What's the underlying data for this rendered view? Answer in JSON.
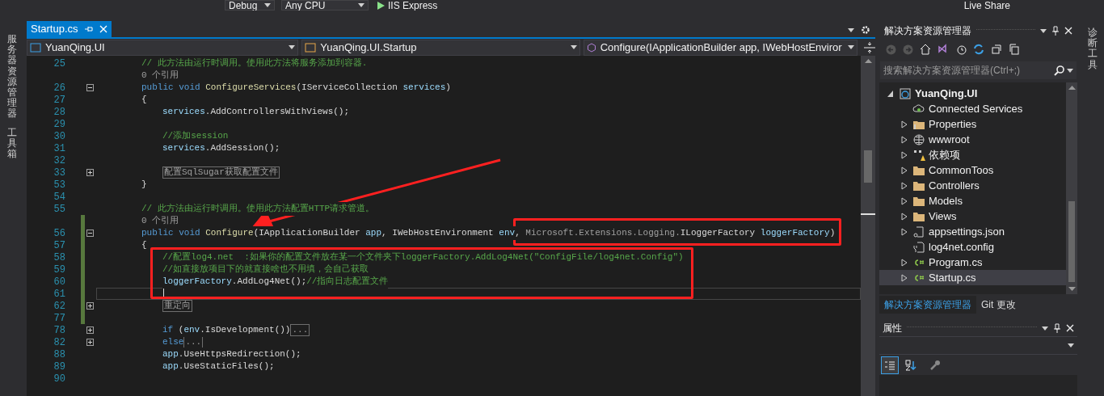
{
  "toolbar": {
    "items": [
      {
        "kind": "dropdown",
        "label": "Debug"
      },
      {
        "kind": "dropdown",
        "label": "Any CPU"
      },
      {
        "kind": "run",
        "label": "IIS Express"
      }
    ],
    "live_share": "Live Share"
  },
  "left_strip": [
    "服务器资源管理器",
    "工具箱"
  ],
  "right_strip": [
    "诊断工具"
  ],
  "editor": {
    "tabs": [
      {
        "label": "Startup.cs",
        "selected": true
      }
    ],
    "nav": [
      "YuanQing.UI",
      "YuanQing.UI.Startup",
      "Configure(IApplicationBuilder app, IWebHostEnviror"
    ],
    "lines": [
      {
        "number": "25",
        "segments": [
          {
            "text": "// 此方法由运行时调用。使用此方法将服务添加到容器.",
            "kind": "comment"
          }
        ]
      },
      {
        "segments": [
          {
            "text": "0 个引用",
            "kind": "lens"
          }
        ]
      },
      {
        "number": "26",
        "folded": false,
        "segments": [
          {
            "text": "public void ",
            "kind": "kw"
          },
          {
            "text": "ConfigureServices",
            "kind": "method"
          },
          {
            "text": "(IServiceCollection ",
            "kind": "plain"
          },
          {
            "text": "services",
            "kind": "ident"
          },
          {
            "text": ")",
            "kind": "plain"
          }
        ]
      },
      {
        "number": "27",
        "segments": [
          {
            "text": "{",
            "kind": "plain"
          }
        ],
        "children": [
          {
            "number": "28",
            "segments": [
              {
                "text": "services",
                "kind": "ident"
              },
              {
                "text": ".AddControllersWithViews();",
                "kind": "plain"
              }
            ]
          },
          {
            "number": "29"
          },
          {
            "number": "30",
            "segments": [
              {
                "text": "//添加session",
                "kind": "comment"
              }
            ]
          },
          {
            "number": "31",
            "segments": [
              {
                "text": "services",
                "kind": "ident"
              },
              {
                "text": ".AddSession();",
                "kind": "plain"
              }
            ]
          },
          {
            "number": "32"
          },
          {
            "number": "33",
            "folded": true,
            "segments": [
              {
                "text": "配置SqlSugar获取配置文件",
                "kind": "collapsed"
              }
            ]
          }
        ]
      },
      {
        "number": "53",
        "segments": [
          {
            "text": "}",
            "kind": "plain"
          }
        ]
      },
      {
        "number": "54"
      },
      {
        "number": "55",
        "segments": [
          {
            "text": "// 此方法由运行时调用。使用此方法配置HTTP请求管道。",
            "kind": "comment"
          }
        ]
      },
      {
        "changed": true,
        "segments": [
          {
            "text": "0 个引用",
            "kind": "lens"
          }
        ]
      },
      {
        "number": "56",
        "folded": false,
        "changed": true,
        "segments": [
          {
            "text": "public void ",
            "kind": "kw"
          },
          {
            "text": "Configure",
            "kind": "method"
          },
          {
            "text": "(IApplicationBuilder ",
            "kind": "plain"
          },
          {
            "text": "app",
            "kind": "ident"
          },
          {
            "text": ", IWebHostEnvironment ",
            "kind": "plain"
          },
          {
            "text": "env",
            "kind": "ident"
          },
          {
            "text": ", ",
            "kind": "plain"
          },
          {
            "text": "Microsoft.Extensions.Logging.",
            "kind": "dim"
          },
          {
            "text": "ILoggerFactory ",
            "kind": "plain"
          },
          {
            "text": "loggerFactory",
            "kind": "ident"
          },
          {
            "text": ")",
            "kind": "plain"
          }
        ]
      },
      {
        "number": "57",
        "changed": true,
        "segments": [
          {
            "text": "{",
            "kind": "plain"
          }
        ],
        "children": [
          {
            "number": "58",
            "changed": true,
            "segments": [
              {
                "text": "//配置log4.net  :如果你的配置文件放在某一个文件夹下loggerFactory.AddLog4Net(\"ConfigFile/log4net.Config\")",
                "kind": "comment"
              }
            ]
          },
          {
            "number": "59",
            "changed": true,
            "segments": [
              {
                "text": "//如直接放项目下的就直接啥也不用填，会自己获取",
                "kind": "comment"
              }
            ]
          },
          {
            "number": "60",
            "changed": true,
            "segments": [
              {
                "text": "loggerFactory",
                "kind": "ident"
              },
              {
                "text": ".AddLog4Net();",
                "kind": "plain"
              },
              {
                "text": "//指向日志配置文件",
                "kind": "comment"
              }
            ]
          },
          {
            "number": "61",
            "changed": true,
            "current": true
          },
          {
            "number": "62",
            "changed": true,
            "folded": true,
            "segments": [
              {
                "text": "重定向",
                "kind": "collapsed"
              }
            ]
          },
          {
            "number": "77",
            "changed": true
          },
          {
            "number": "78",
            "folded": true,
            "segments": [
              {
                "text": "if",
                "kind": "kw"
              },
              {
                "text": " (",
                "kind": "plain"
              },
              {
                "text": "env",
                "kind": "ident"
              },
              {
                "text": ".IsDevelopment())",
                "kind": "plain"
              },
              {
                "text": "...",
                "kind": "collapsed"
              }
            ]
          },
          {
            "number": "82",
            "folded": true,
            "segments": [
              {
                "text": "else",
                "kind": "kw"
              },
              {
                "text": "...",
                "kind": "collapsed"
              }
            ]
          },
          {
            "number": "88",
            "segments": [
              {
                "text": "app",
                "kind": "ident"
              },
              {
                "text": ".UseHttpsRedirection();",
                "kind": "plain"
              }
            ]
          },
          {
            "number": "89",
            "segments": [
              {
                "text": "app",
                "kind": "ident"
              },
              {
                "text": ".UseStaticFiles();",
                "kind": "plain"
              }
            ]
          },
          {
            "number": "90"
          }
        ]
      }
    ],
    "annotations": [
      {
        "kind": "box"
      },
      {
        "kind": "box"
      },
      {
        "kind": "arrow"
      }
    ]
  },
  "solution_explorer": {
    "title": "解决方案资源管理器",
    "search": {
      "placeholder": "搜索解决方案资源管理器(Ctrl+;)"
    },
    "tree": [
      {
        "label": "YuanQing.UI",
        "kind": "project",
        "expanded": true,
        "selected": false,
        "children": [
          {
            "label": "Connected Services",
            "kind": "service",
            "selected": false
          },
          {
            "label": "Properties",
            "kind": "properties",
            "expanded": false,
            "selected": false
          },
          {
            "label": "wwwroot",
            "kind": "web",
            "expanded": false,
            "selected": false
          },
          {
            "label": "依赖项",
            "kind": "deps",
            "expanded": false,
            "selected": false
          },
          {
            "label": "CommonToos",
            "kind": "folder",
            "expanded": false,
            "selected": false
          },
          {
            "label": "Controllers",
            "kind": "folder",
            "expanded": false,
            "selected": false
          },
          {
            "label": "Models",
            "kind": "folder",
            "expanded": false,
            "selected": false
          },
          {
            "label": "Views",
            "kind": "folder",
            "expanded": false,
            "selected": false
          },
          {
            "label": "appsettings.json",
            "kind": "json",
            "expanded": false,
            "selected": false
          },
          {
            "label": "log4net.config",
            "kind": "config",
            "selected": false
          },
          {
            "label": "Program.cs",
            "kind": "csharp",
            "expanded": false,
            "selected": false
          },
          {
            "label": "Startup.cs",
            "kind": "csharp",
            "expanded": false,
            "selected": true
          }
        ]
      }
    ],
    "tabs": [
      {
        "label": "解决方案资源管理器",
        "selected": true
      },
      {
        "label": "Git 更改",
        "selected": false
      }
    ]
  },
  "properties": {
    "title": "属性",
    "view_buttons": [
      {
        "kind": "categorized",
        "selected": true
      },
      {
        "kind": "alphabetical",
        "selected": false
      },
      {
        "kind": "pages",
        "selected": false
      }
    ]
  }
}
